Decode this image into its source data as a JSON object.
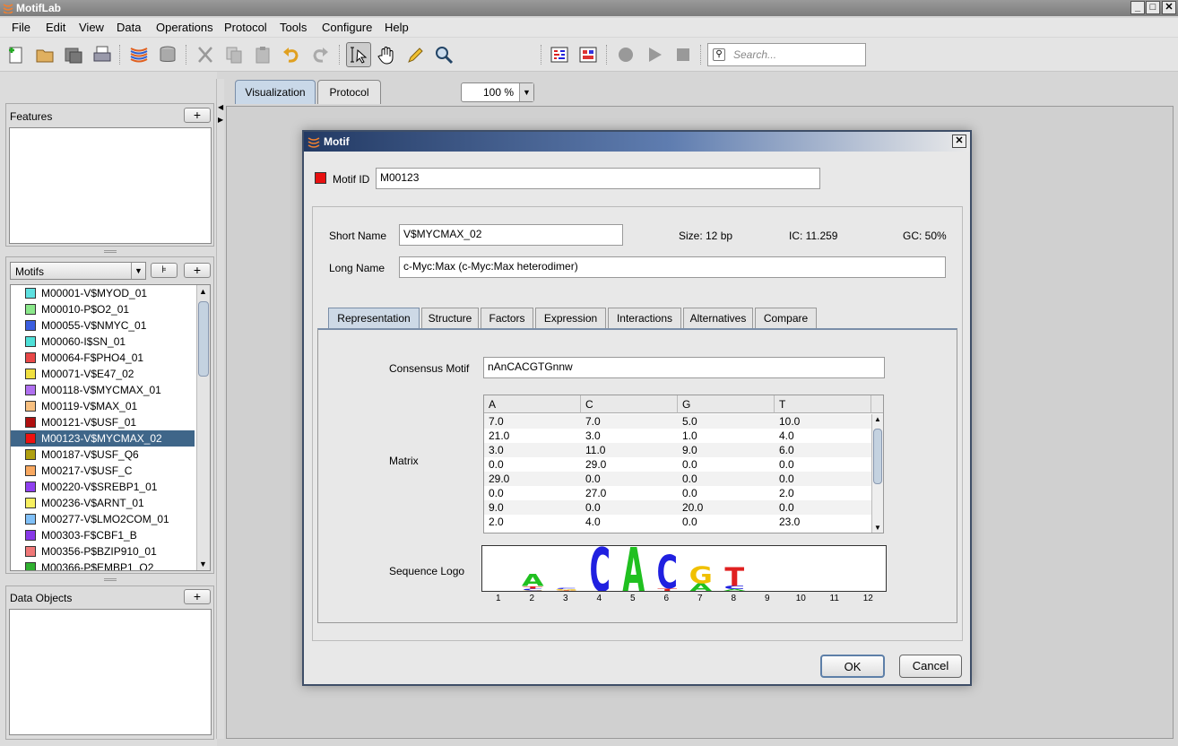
{
  "app": {
    "title": "MotifLab"
  },
  "menu": [
    "File",
    "Edit",
    "View",
    "Data",
    "Operations",
    "Protocol",
    "Tools",
    "Configure",
    "Help"
  ],
  "toolbar": {
    "zoom": "100 %",
    "search_placeholder": "Search..."
  },
  "left": {
    "features_title": "Features",
    "motifs_selector": "Motifs",
    "data_objects_title": "Data Objects",
    "plus": "+",
    "motifs": [
      {
        "label": "M00001-V$MYOD_01",
        "color": "#5ee0e0"
      },
      {
        "label": "M00010-P$O2_01",
        "color": "#8ae88a"
      },
      {
        "label": "M00055-V$NMYC_01",
        "color": "#3b5ee0"
      },
      {
        "label": "M00060-I$SN_01",
        "color": "#4ee0d8"
      },
      {
        "label": "M00064-F$PHO4_01",
        "color": "#e84848"
      },
      {
        "label": "M00071-V$E47_02",
        "color": "#f0e040"
      },
      {
        "label": "M00118-V$MYCMAX_01",
        "color": "#b070f0"
      },
      {
        "label": "M00119-V$MAX_01",
        "color": "#f8c080"
      },
      {
        "label": "M00121-V$USF_01",
        "color": "#b01010"
      },
      {
        "label": "M00123-V$MYCMAX_02",
        "color": "#f01010",
        "selected": true
      },
      {
        "label": "M00187-V$USF_Q6",
        "color": "#b0a010"
      },
      {
        "label": "M00217-V$USF_C",
        "color": "#f8a860"
      },
      {
        "label": "M00220-V$SREBP1_01",
        "color": "#9040f0"
      },
      {
        "label": "M00236-V$ARNT_01",
        "color": "#f8f060"
      },
      {
        "label": "M00277-V$LMO2COM_01",
        "color": "#80c0f8"
      },
      {
        "label": "M00303-F$CBF1_B",
        "color": "#8838e8"
      },
      {
        "label": "M00356-P$BZIP910_01",
        "color": "#f07878"
      },
      {
        "label": "M00366-P$EMBP1_Q2",
        "color": "#30b030"
      }
    ]
  },
  "main_tabs": [
    "Visualization",
    "Protocol"
  ],
  "dialog": {
    "title": "Motif",
    "motif_id_label": "Motif ID",
    "motif_id": "M00123",
    "motif_color": "#e81010",
    "short_name_label": "Short Name",
    "short_name": "V$MYCMAX_02",
    "size": "Size: 12 bp",
    "ic": "IC: 11.259",
    "gc": "GC: 50%",
    "long_name_label": "Long Name",
    "long_name": "c-Myc:Max (c-Myc:Max heterodimer)",
    "tabs": [
      "Representation",
      "Structure",
      "Factors",
      "Expression",
      "Interactions",
      "Alternatives",
      "Compare"
    ],
    "consensus_label": "Consensus Motif",
    "consensus": "nAnCACGTGnnw",
    "matrix_label": "Matrix",
    "matrix_headers": [
      "A",
      "C",
      "G",
      "T"
    ],
    "matrix_rows": [
      [
        "7.0",
        "7.0",
        "5.0",
        "10.0"
      ],
      [
        "21.0",
        "3.0",
        "1.0",
        "4.0"
      ],
      [
        "3.0",
        "11.0",
        "9.0",
        "6.0"
      ],
      [
        "0.0",
        "29.0",
        "0.0",
        "0.0"
      ],
      [
        "29.0",
        "0.0",
        "0.0",
        "0.0"
      ],
      [
        "0.0",
        "27.0",
        "0.0",
        "2.0"
      ],
      [
        "9.0",
        "0.0",
        "20.0",
        "0.0"
      ],
      [
        "2.0",
        "4.0",
        "0.0",
        "23.0"
      ]
    ],
    "logo_label": "Sequence Logo",
    "logo_positions": [
      "1",
      "2",
      "3",
      "4",
      "5",
      "6",
      "7",
      "8",
      "9",
      "10",
      "11",
      "12"
    ],
    "logo_letters": {
      "A": "#20c020",
      "C": "#2020e0",
      "G": "#f0c000",
      "T": "#e02020"
    },
    "ok": "OK",
    "cancel": "Cancel"
  }
}
